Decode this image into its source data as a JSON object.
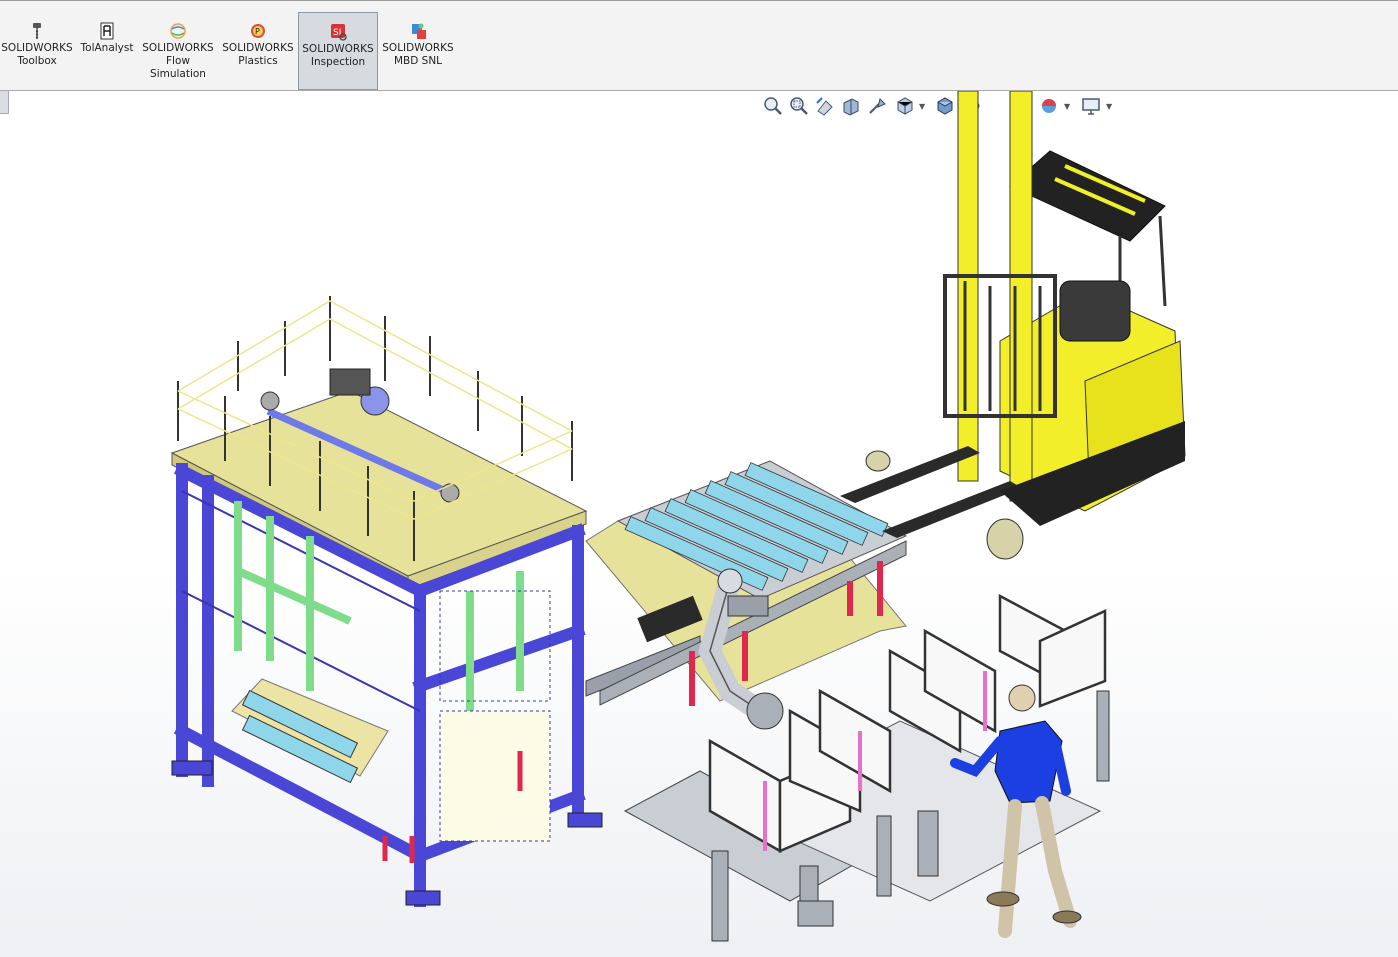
{
  "ribbon": {
    "tools": [
      {
        "name": "toolbox-button",
        "icon": "toolbox-icon",
        "label": "SOLIDWORKS\nToolbox",
        "active": false
      },
      {
        "name": "tolanalyst-button",
        "icon": "tolanalyst-icon",
        "label": "TolAnalyst",
        "active": false
      },
      {
        "name": "flow-simulation-button",
        "icon": "flow-simulation-icon",
        "label": "SOLIDWORKS\nFlow\nSimulation",
        "active": false
      },
      {
        "name": "plastics-button",
        "icon": "plastics-icon",
        "label": "SOLIDWORKS\nPlastics",
        "active": false
      },
      {
        "name": "inspection-button",
        "icon": "inspection-icon",
        "label": "SOLIDWORKS\nInspection",
        "active": true
      },
      {
        "name": "mbd-snl-button",
        "icon": "mbd-snl-icon",
        "label": "SOLIDWORKS\nMBD SNL",
        "active": false
      }
    ]
  },
  "heads_up_toolbar": [
    "zoom-to-fit-icon",
    "zoom-to-area-icon",
    "previous-view-icon",
    "section-view-icon",
    "dynamic-annotation-icon",
    "view-orientation-icon",
    "display-style-icon",
    "hide-show-items-icon",
    "edit-appearance-icon",
    "apply-scene-icon",
    "view-settings-icon"
  ],
  "colors": {
    "frame_blue": "#4a46d6",
    "frame_green": "#7fdc8a",
    "platform_yellow": "#e6e29a",
    "forklift_yellow": "#f2ef2a",
    "roller_cyan": "#8fd6ea",
    "leg_red": "#e0284f",
    "worker_blue": "#1b3fe0",
    "grey_steel": "#9aa0aa"
  }
}
